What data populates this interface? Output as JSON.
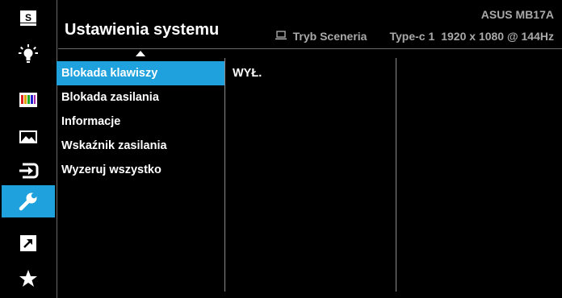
{
  "header": {
    "title": "Ustawienia systemu",
    "model": "ASUS MB17A",
    "scene_mode": "Tryb Sceneria",
    "input": "Type-c 1",
    "resolution": "1920 x 1080 @ 144Hz"
  },
  "sidebar": {
    "items": [
      {
        "name": "splendid",
        "icon": "s-box-icon",
        "active": false
      },
      {
        "name": "blue-light-filter",
        "icon": "lightbulb-icon",
        "active": false
      },
      {
        "name": "color",
        "icon": "color-bars-icon",
        "active": false
      },
      {
        "name": "image",
        "icon": "landscape-image-icon",
        "active": false
      },
      {
        "name": "input-select",
        "icon": "input-select-icon",
        "active": false
      },
      {
        "name": "system-setup",
        "icon": "wrench-icon",
        "active": true
      },
      {
        "name": "shortcut",
        "icon": "shortcut-arrow-icon",
        "active": false
      },
      {
        "name": "my-favorite",
        "icon": "star-icon",
        "active": false
      }
    ]
  },
  "menu": {
    "items": [
      {
        "label": "Blokada klawiszy",
        "active": true
      },
      {
        "label": "Blokada zasilania",
        "active": false
      },
      {
        "label": "Informacje",
        "active": false
      },
      {
        "label": "Wskaźnik zasilania",
        "active": false
      },
      {
        "label": "Wyzeruj wszystko",
        "active": false
      }
    ]
  },
  "submenu": {
    "value": "WYŁ."
  },
  "colors": {
    "background": "#000000",
    "accent": "#1ea1dc",
    "text": "#ffffff",
    "muted_text": "#a9a9a9",
    "separator": "#6b6b6b"
  }
}
